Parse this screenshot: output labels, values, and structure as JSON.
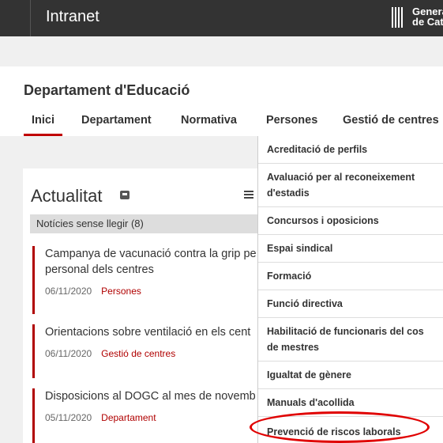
{
  "topbar": {
    "title": "Intranet",
    "logo_text_1": "Genera",
    "logo_text_2": "de Cat"
  },
  "header": {
    "department": "Departament d'Educació"
  },
  "tabs": [
    "Inici",
    "Departament",
    "Normativa",
    "Persones",
    "Gestió de centres"
  ],
  "news": {
    "title": "Actualitat",
    "unread": "Notícies sense llegir (8)",
    "items": [
      {
        "title_line1": "Campanya de vacunació contra la grip pe",
        "title_line2": "personal dels centres",
        "date": "06/11/2020",
        "category": "Persones"
      },
      {
        "title_line1": "Orientacions sobre ventilació en els cent",
        "date": "06/11/2020",
        "category": "Gestió de centres"
      },
      {
        "title_line1": "Disposicions al DOGC al mes de novemb",
        "date": "05/11/2020",
        "category": "Departament"
      }
    ]
  },
  "dropdown": {
    "items": [
      "Acreditació de perfils",
      "Avaluació per al reconeixement",
      "d'estadis",
      "Concursos i oposicions",
      "Espai sindical",
      "Formació",
      "Funció directiva",
      "Habilitació de funcionaris del cos",
      "de mestres",
      "Igualtat de gènere",
      "Manuals d'acollida",
      "Prevenció de riscos laborals"
    ]
  },
  "colors": {
    "accent": "#b00000",
    "topbar": "#333333",
    "highlight": "#e00000"
  }
}
